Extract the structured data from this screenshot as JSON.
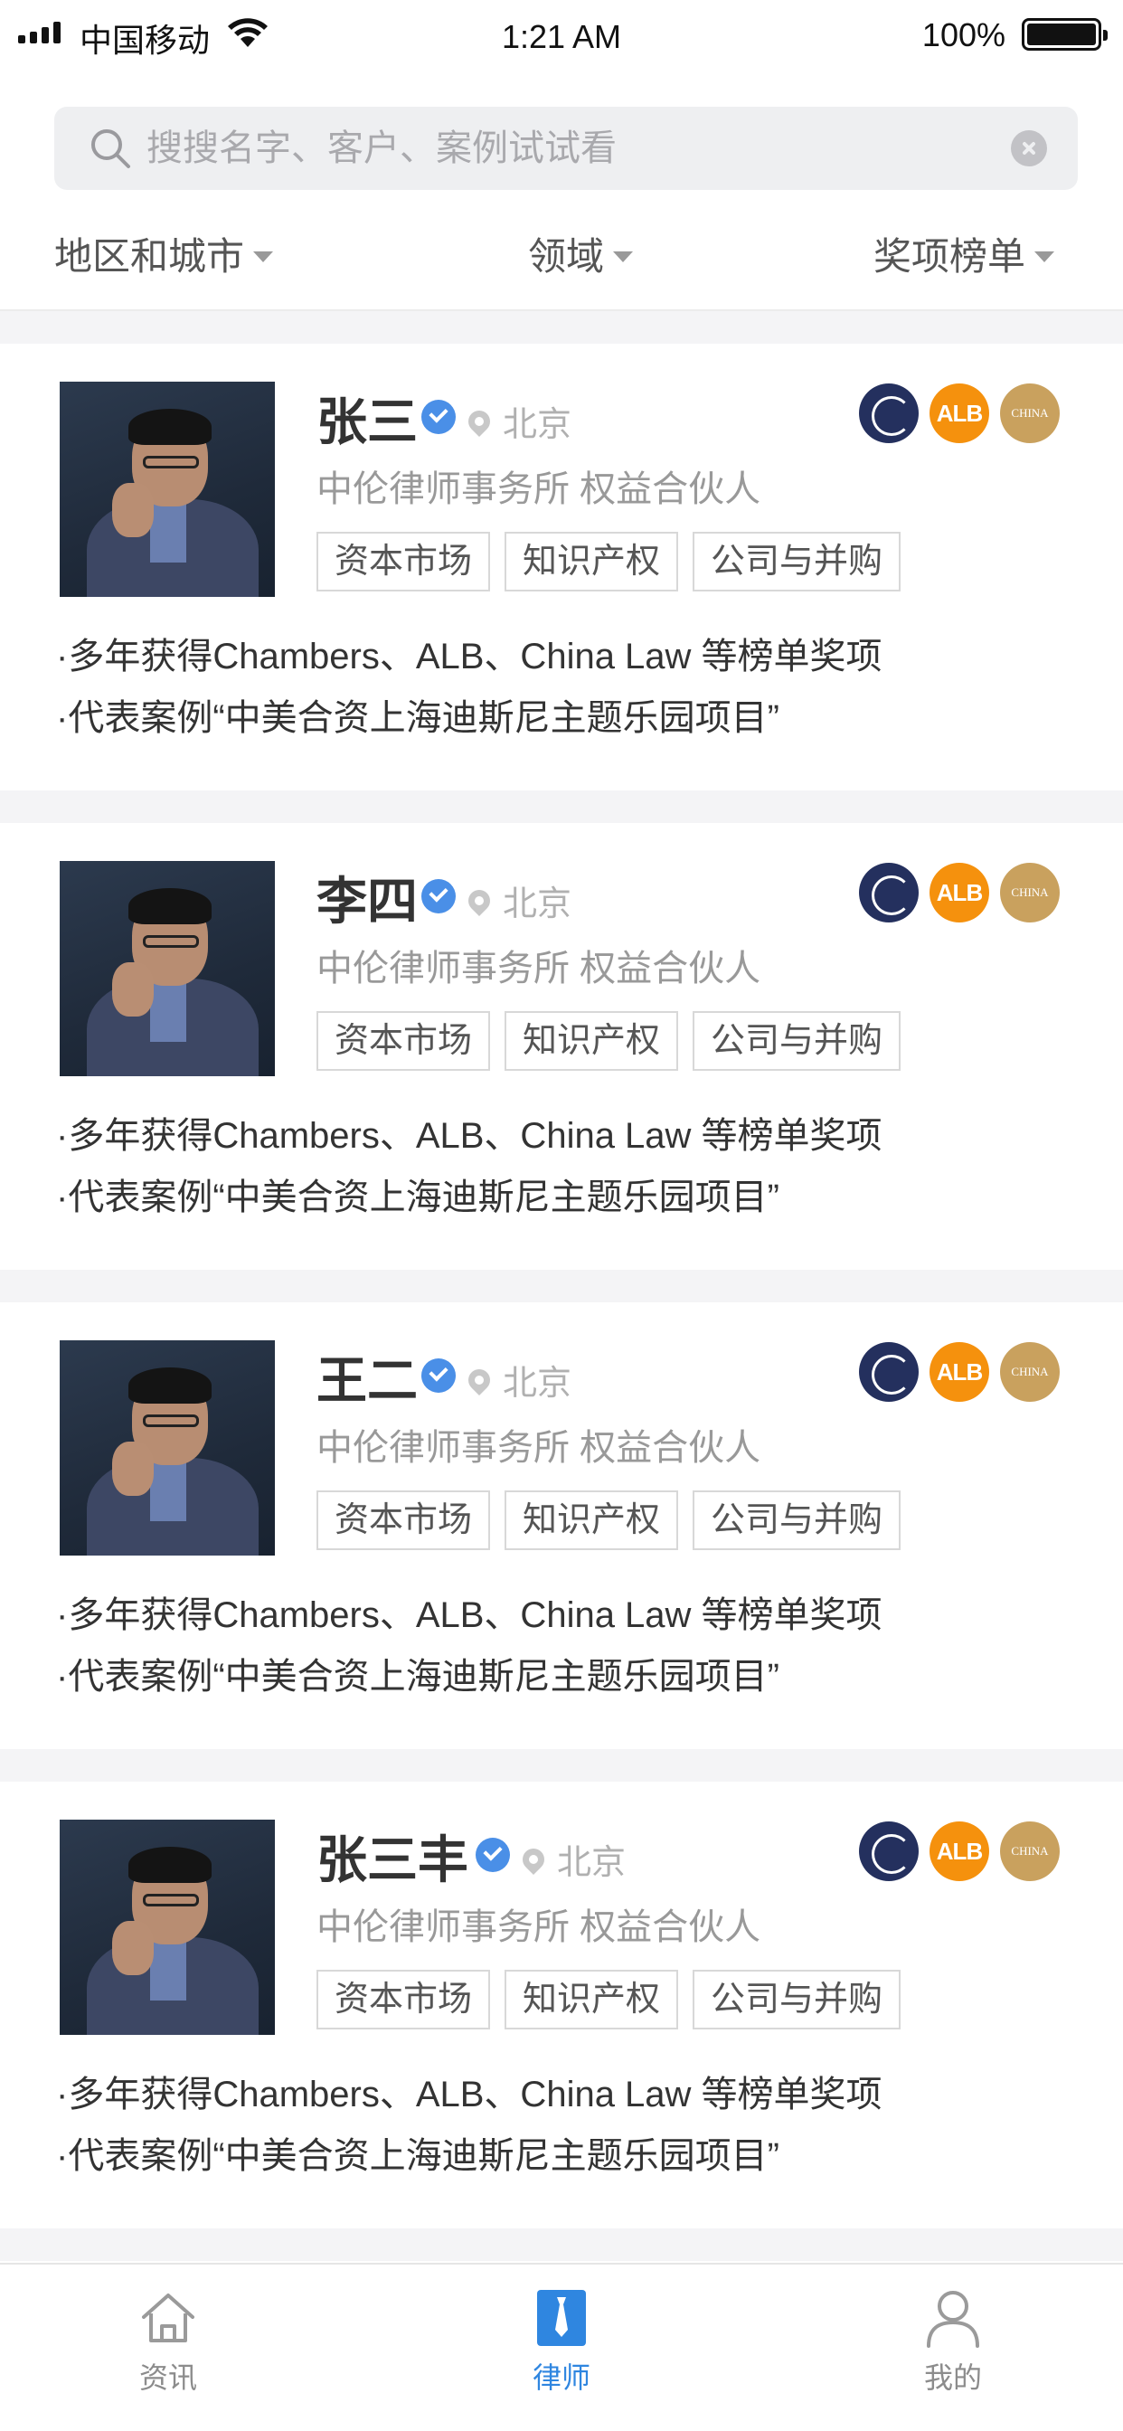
{
  "status_bar": {
    "carrier": "中国移动",
    "time": "1:21 AM",
    "battery": "100%"
  },
  "search": {
    "placeholder": "搜搜名字、客户、案例试试看"
  },
  "filters": [
    "地区和城市",
    "领域",
    "奖项榜单"
  ],
  "lawyers": [
    {
      "name": "张三",
      "location": "北京",
      "firm": "中伦律师事务所 权益合伙人",
      "tags": [
        "资本市场",
        "知识产权",
        "公司与并购"
      ],
      "awards": [
        "chambers-icon",
        "ALB",
        "CHINA"
      ],
      "bullets": [
        "·多年获得Chambers、ALB、China Law 等榜单奖项",
        "·代表案例“中美合资上海迪斯尼主题乐园项目”"
      ]
    },
    {
      "name": "李四",
      "location": "北京",
      "firm": "中伦律师事务所 权益合伙人",
      "tags": [
        "资本市场",
        "知识产权",
        "公司与并购"
      ],
      "awards": [
        "chambers-icon",
        "ALB",
        "CHINA"
      ],
      "bullets": [
        "·多年获得Chambers、ALB、China Law 等榜单奖项",
        "·代表案例“中美合资上海迪斯尼主题乐园项目”"
      ]
    },
    {
      "name": "王二",
      "location": "北京",
      "firm": "中伦律师事务所 权益合伙人",
      "tags": [
        "资本市场",
        "知识产权",
        "公司与并购"
      ],
      "awards": [
        "chambers-icon",
        "ALB",
        "CHINA"
      ],
      "bullets": [
        "·多年获得Chambers、ALB、China Law 等榜单奖项",
        "·代表案例“中美合资上海迪斯尼主题乐园项目”"
      ]
    },
    {
      "name": "张三丰",
      "location": "北京",
      "firm": "中伦律师事务所 权益合伙人",
      "tags": [
        "资本市场",
        "知识产权",
        "公司与并购"
      ],
      "awards": [
        "chambers-icon",
        "ALB",
        "CHINA"
      ],
      "bullets": [
        "·多年获得Chambers、ALB、China Law 等榜单奖项",
        "·代表案例“中美合资上海迪斯尼主题乐园项目”"
      ]
    }
  ],
  "tabbar": {
    "items": [
      {
        "label": "资讯",
        "icon": "home-icon"
      },
      {
        "label": "律师",
        "icon": "lawyer-tie-icon"
      },
      {
        "label": "我的",
        "icon": "user-icon"
      }
    ],
    "active_index": 1,
    "active_color": "#2f86e0"
  }
}
